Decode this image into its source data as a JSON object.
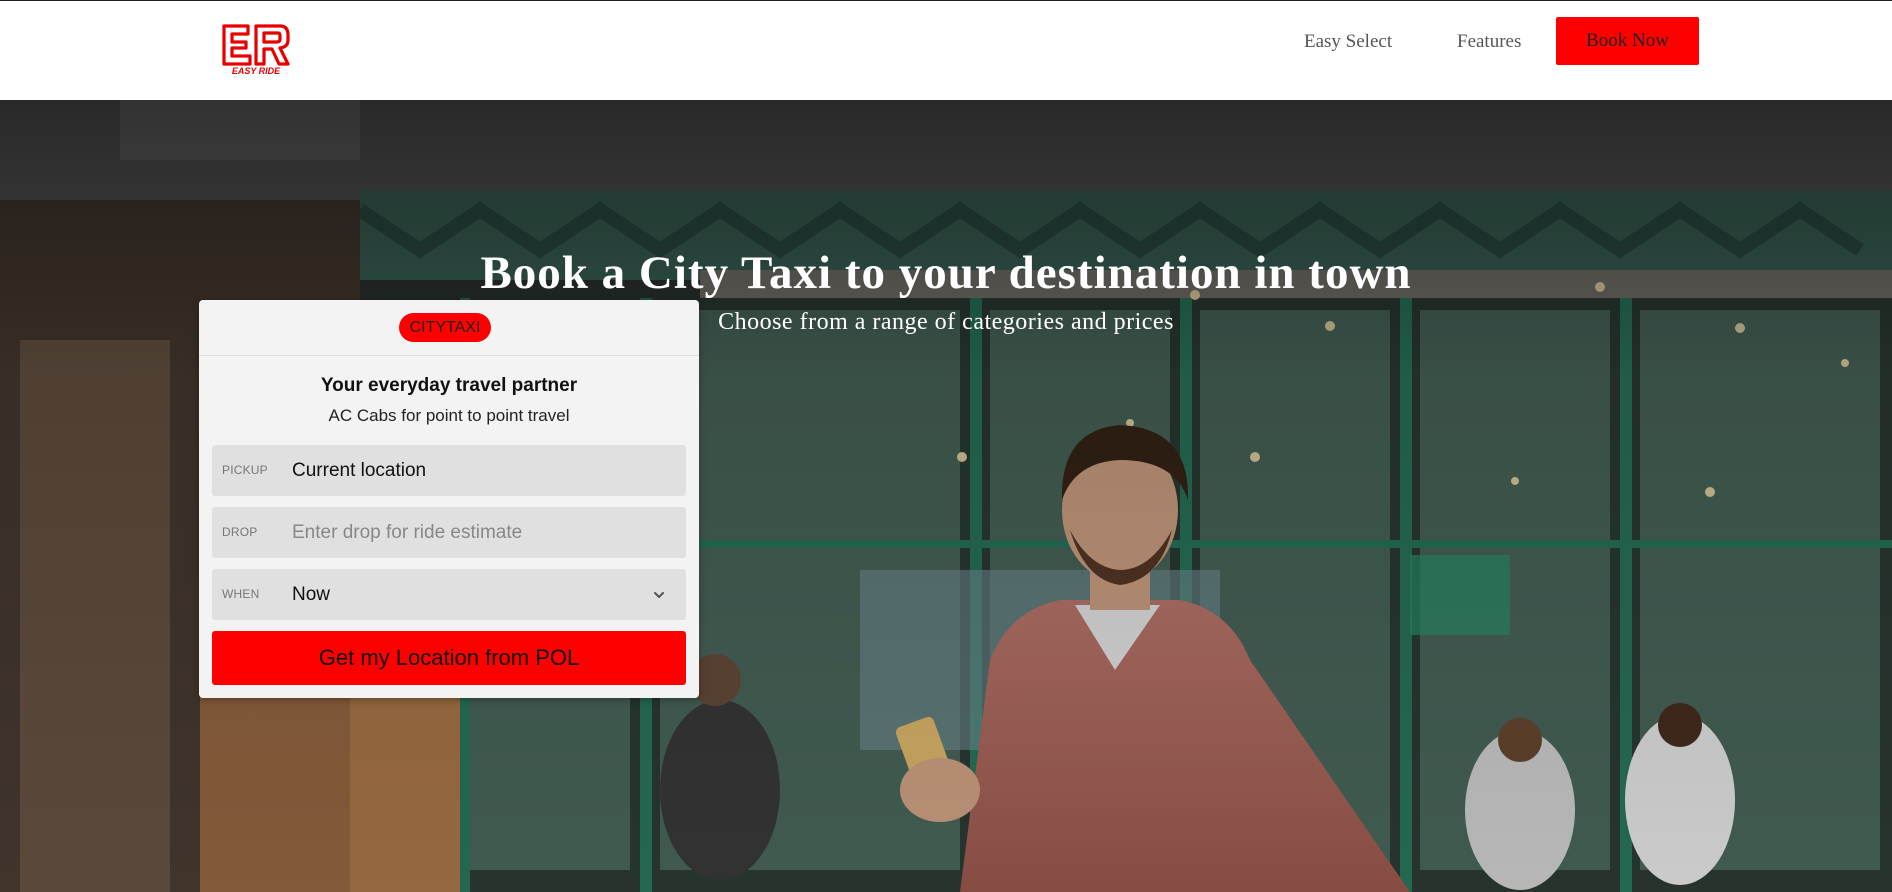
{
  "brand": {
    "logo_text": "EASY RIDE",
    "accent": "#ff0000"
  },
  "nav": {
    "easy_select": "Easy Select",
    "features": "Features",
    "book_now": "Book Now"
  },
  "hero": {
    "title": "Book a City Taxi to your destination in town",
    "subtitle": "Choose from a range of categories and prices"
  },
  "booking_card": {
    "badge": "CITYTAXI",
    "title": "Your everyday travel partner",
    "subtitle": "AC Cabs for point to point travel",
    "pickup": {
      "label": "PICKUP",
      "value": "Current location"
    },
    "drop": {
      "label": "DROP",
      "placeholder": "Enter drop for ride estimate"
    },
    "when": {
      "label": "WHEN",
      "selected": "Now"
    },
    "submit_label": "Get my Location from POL"
  }
}
